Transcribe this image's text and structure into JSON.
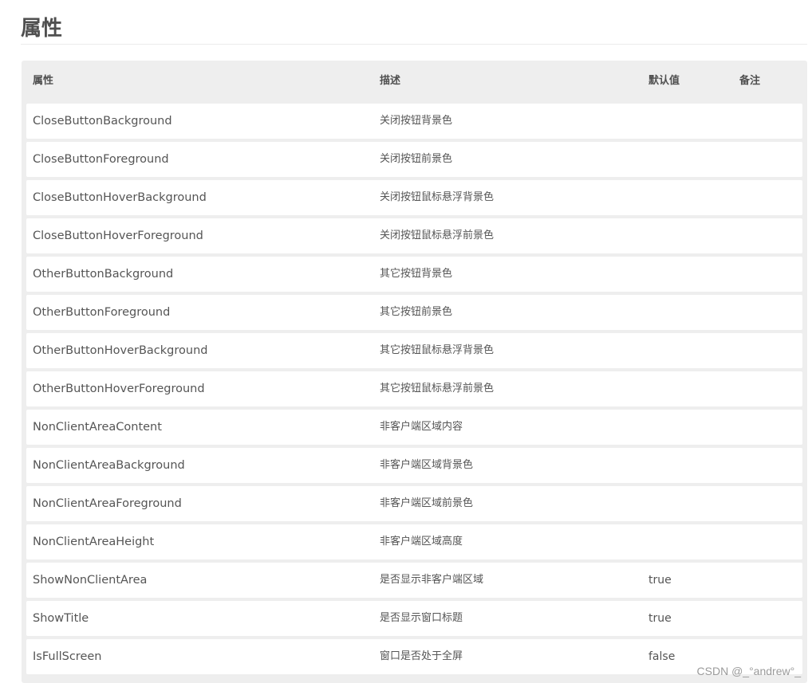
{
  "heading": "属性",
  "table": {
    "headers": {
      "name": "属性",
      "desc": "描述",
      "default": "默认值",
      "note": "备注"
    },
    "rows": [
      {
        "name": "CloseButtonBackground",
        "desc": "关闭按钮背景色",
        "default": "",
        "note": ""
      },
      {
        "name": "CloseButtonForeground",
        "desc": "关闭按钮前景色",
        "default": "",
        "note": ""
      },
      {
        "name": "CloseButtonHoverBackground",
        "desc": "关闭按钮鼠标悬浮背景色",
        "default": "",
        "note": ""
      },
      {
        "name": "CloseButtonHoverForeground",
        "desc": "关闭按钮鼠标悬浮前景色",
        "default": "",
        "note": ""
      },
      {
        "name": "OtherButtonBackground",
        "desc": "其它按钮背景色",
        "default": "",
        "note": ""
      },
      {
        "name": "OtherButtonForeground",
        "desc": "其它按钮前景色",
        "default": "",
        "note": ""
      },
      {
        "name": "OtherButtonHoverBackground",
        "desc": "其它按钮鼠标悬浮背景色",
        "default": "",
        "note": ""
      },
      {
        "name": "OtherButtonHoverForeground",
        "desc": "其它按钮鼠标悬浮前景色",
        "default": "",
        "note": ""
      },
      {
        "name": "NonClientAreaContent",
        "desc": "非客户端区域内容",
        "default": "",
        "note": ""
      },
      {
        "name": "NonClientAreaBackground",
        "desc": "非客户端区域背景色",
        "default": "",
        "note": ""
      },
      {
        "name": "NonClientAreaForeground",
        "desc": "非客户端区域前景色",
        "default": "",
        "note": ""
      },
      {
        "name": "NonClientAreaHeight",
        "desc": "非客户端区域高度",
        "default": "",
        "note": ""
      },
      {
        "name": "ShowNonClientArea",
        "desc": "是否显示非客户端区域",
        "default": "true",
        "note": ""
      },
      {
        "name": "ShowTitle",
        "desc": "是否显示窗口标题",
        "default": "true",
        "note": ""
      },
      {
        "name": "IsFullScreen",
        "desc": "窗口是否处于全屏",
        "default": "false",
        "note": ""
      }
    ]
  },
  "watermark": "CSDN @_°andrew°_"
}
